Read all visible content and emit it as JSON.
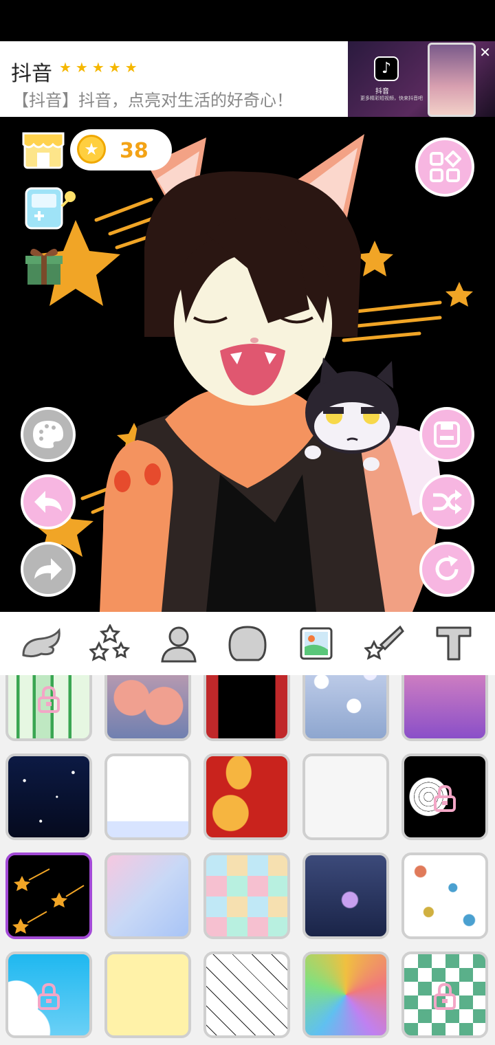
{
  "ad": {
    "title": "抖音",
    "stars": "★★★★★",
    "description": "【抖音】抖音，点亮对生活的好奇心！",
    "media_label": "抖音",
    "media_sub": "更多精彩短视频，快来抖音吧",
    "close_symbol": "✕"
  },
  "canvas": {
    "coin_symbol": "★",
    "coins": "38"
  },
  "tabs": [
    {
      "name": "wings-tab"
    },
    {
      "name": "sparkles-tab"
    },
    {
      "name": "person-tab"
    },
    {
      "name": "head-tab"
    },
    {
      "name": "background-tab",
      "active": true
    },
    {
      "name": "effects-tab"
    },
    {
      "name": "text-tab"
    }
  ],
  "colors": {
    "accent_pink": "#f7b6e1",
    "gray_button": "#b7b7b7",
    "coin": "#f3a316",
    "selected_border": "#a34ad6"
  },
  "backgrounds": [
    {
      "name": "bamboo",
      "locked": true
    },
    {
      "name": "pink-clouds",
      "locked": false
    },
    {
      "name": "red-curtain",
      "locked": false
    },
    {
      "name": "bokeh",
      "locked": false
    },
    {
      "name": "purple-sparkle",
      "locked": false
    },
    {
      "name": "night-sky",
      "locked": false
    },
    {
      "name": "white-waves",
      "locked": false
    },
    {
      "name": "red-lanterns",
      "locked": false
    },
    {
      "name": "white-birds",
      "locked": false
    },
    {
      "name": "spider-web",
      "locked": true
    },
    {
      "name": "shooting-stars",
      "locked": false,
      "selected": true
    },
    {
      "name": "pastel-polygon",
      "locked": false
    },
    {
      "name": "pastel-checker",
      "locked": false
    },
    {
      "name": "jellyfish",
      "locked": false
    },
    {
      "name": "fish-pattern",
      "locked": false
    },
    {
      "name": "sky-clouds",
      "locked": true
    },
    {
      "name": "yellow-triangles",
      "locked": false
    },
    {
      "name": "paper-planes",
      "locked": false
    },
    {
      "name": "stained-glass",
      "locked": false
    },
    {
      "name": "green-argyle",
      "locked": true
    }
  ]
}
